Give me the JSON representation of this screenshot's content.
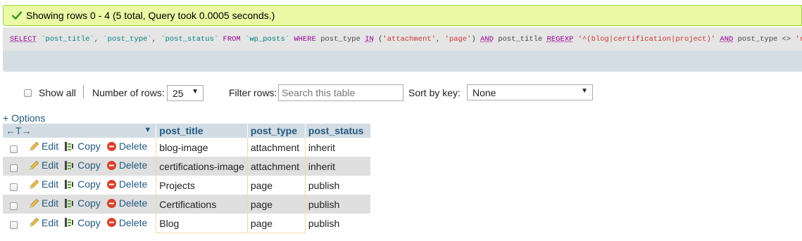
{
  "success_message": "Showing rows 0 - 4 (5 total, Query took 0.0005 seconds.)",
  "sql": {
    "tokens": [
      {
        "t": "SELECT",
        "c": "kw"
      },
      {
        "t": " ",
        "c": "plain"
      },
      {
        "t": "`post_title`",
        "c": "bt"
      },
      {
        "t": ", ",
        "c": "plain"
      },
      {
        "t": "`post_type`",
        "c": "bt"
      },
      {
        "t": ", ",
        "c": "plain"
      },
      {
        "t": "`post_status`",
        "c": "bt"
      },
      {
        "t": " ",
        "c": "plain"
      },
      {
        "t": "FROM",
        "c": "kw-plain"
      },
      {
        "t": " ",
        "c": "plain"
      },
      {
        "t": "`wp_posts`",
        "c": "bt"
      },
      {
        "t": " ",
        "c": "plain"
      },
      {
        "t": "WHERE",
        "c": "kw-plain"
      },
      {
        "t": " post_type ",
        "c": "plain"
      },
      {
        "t": "IN",
        "c": "kw"
      },
      {
        "t": " (",
        "c": "plain"
      },
      {
        "t": "'attachment'",
        "c": "str"
      },
      {
        "t": ", ",
        "c": "plain"
      },
      {
        "t": "'page'",
        "c": "str"
      },
      {
        "t": ") ",
        "c": "plain"
      },
      {
        "t": "AND",
        "c": "kw"
      },
      {
        "t": " post_title ",
        "c": "plain"
      },
      {
        "t": "REGEXP",
        "c": "kw"
      },
      {
        "t": " ",
        "c": "plain"
      },
      {
        "t": "'^(blog|certification|project)'",
        "c": "str"
      },
      {
        "t": " ",
        "c": "plain"
      },
      {
        "t": "AND",
        "c": "kw"
      },
      {
        "t": " post_type <> ",
        "c": "plain"
      },
      {
        "t": "'revision'",
        "c": "str"
      }
    ]
  },
  "controls": {
    "show_all_label": "Show all",
    "number_of_rows_label": "Number of rows:",
    "number_of_rows_value": "25",
    "filter_rows_label": "Filter rows:",
    "filter_placeholder": "Search this table",
    "sort_by_key_label": "Sort by key:",
    "sort_by_key_value": "None"
  },
  "options_link": "+ Options",
  "table": {
    "arrows_label": "←T→",
    "columns": [
      "post_title",
      "post_type",
      "post_status"
    ],
    "actions": {
      "edit": "Edit",
      "copy": "Copy",
      "delete": "Delete"
    },
    "rows": [
      {
        "post_title": "blog-image",
        "post_type": "attachment",
        "post_status": "inherit"
      },
      {
        "post_title": "certifications-image",
        "post_type": "attachment",
        "post_status": "inherit"
      },
      {
        "post_title": "Projects",
        "post_type": "page",
        "post_status": "publish"
      },
      {
        "post_title": "Certifications",
        "post_type": "page",
        "post_status": "publish"
      },
      {
        "post_title": "Blog",
        "post_type": "page",
        "post_status": "publish"
      }
    ]
  },
  "colors": {
    "success_bg": "#ebf8a4",
    "header_bg": "#d3dce3",
    "link": "#235a81",
    "row_alt": "#dfdfdf"
  }
}
